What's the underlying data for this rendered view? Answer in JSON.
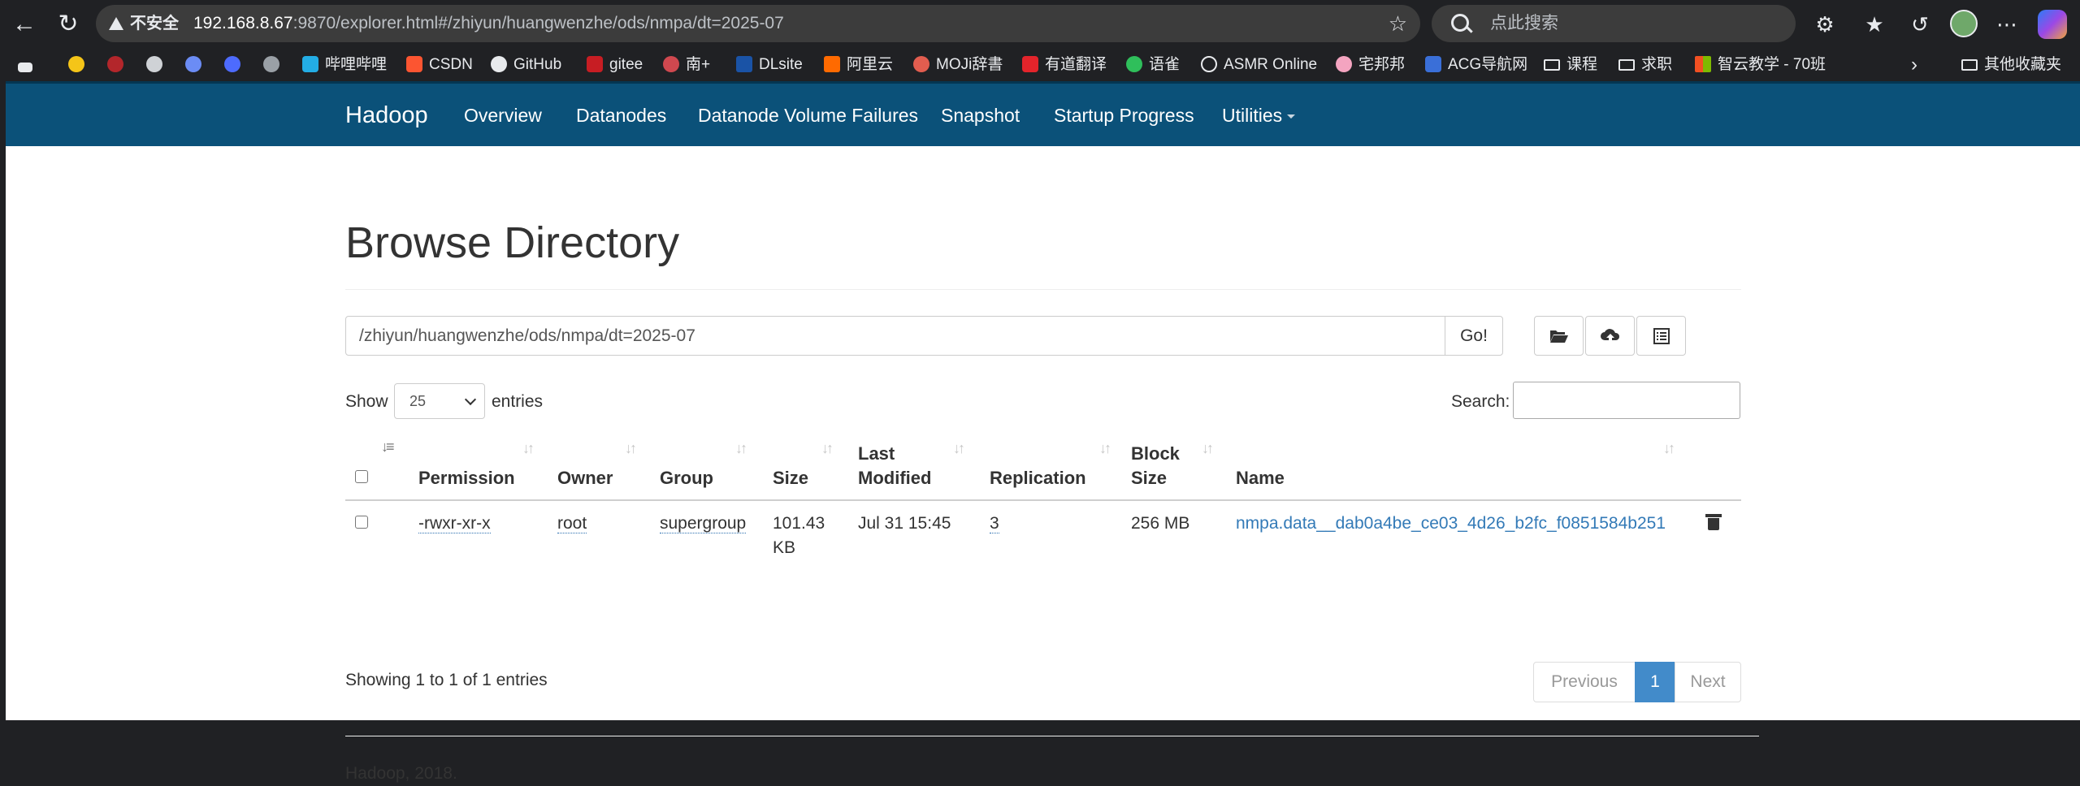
{
  "browser": {
    "url_warning": "不安全",
    "url_host": "192.168.8.67",
    "url_rest": ":9870/explorer.html#/zhiyun/huangwenzhe/ods/nmpa/dt=2025-07",
    "search_placeholder": "点此搜索",
    "bookmarks": [
      "哔哩哔哩",
      "CSDN",
      "GitHub",
      "gitee",
      "南+",
      "DLsite",
      "阿里云",
      "MOJi辞書",
      "有道翻译",
      "语雀",
      "ASMR Online",
      "宅邦邦",
      "ACG导航网",
      "课程",
      "求职",
      "智云教学 - 70班",
      "其他收藏夹"
    ],
    "icons": {
      "back": "back-arrow-icon",
      "refresh": "refresh-icon",
      "star": "star-icon",
      "extensions": "puzzle-icon",
      "favorites": "favorites-icon",
      "history": "history-icon",
      "more": "more-dots-icon",
      "overflow": "chevron-right-icon"
    }
  },
  "navbar": {
    "brand": "Hadoop",
    "items": [
      "Overview",
      "Datanodes",
      "Datanode Volume Failures",
      "Snapshot",
      "Startup Progress",
      "Utilities"
    ],
    "bg_color": "#0b5179"
  },
  "main": {
    "title": "Browse Directory",
    "path_value": "/zhiyun/huangwenzhe/ods/nmpa/dt=2025-07",
    "go_label": "Go!",
    "icon_buttons": [
      "folder-open-icon",
      "cloud-upload-icon",
      "list-alt-icon"
    ],
    "show_label": "Show",
    "page_size": "25",
    "entries_label": "entries",
    "search_label": "Search:"
  },
  "table": {
    "headers": {
      "permission": "Permission",
      "owner": "Owner",
      "group": "Group",
      "size": "Size",
      "last_modified_1": "Last",
      "last_modified_2": "Modified",
      "replication": "Replication",
      "block_size_1": "Block",
      "block_size_2": "Size",
      "name": "Name"
    },
    "rows": [
      {
        "permission": "-rwxr-xr-x",
        "owner": "root",
        "group": "supergroup",
        "size_1": "101.43",
        "size_2": "KB",
        "last_modified": "Jul 31 15:45",
        "replication": "3",
        "block_size": "256 MB",
        "name": "nmpa.data__dab0a4be_ce03_4d26_b2fc_f0851584b251"
      }
    ]
  },
  "pagination": {
    "info": "Showing 1 to 1 of 1 entries",
    "previous": "Previous",
    "current": "1",
    "next": "Next",
    "active_color": "#428bca"
  },
  "footer": {
    "text": "Hadoop, 2018."
  }
}
